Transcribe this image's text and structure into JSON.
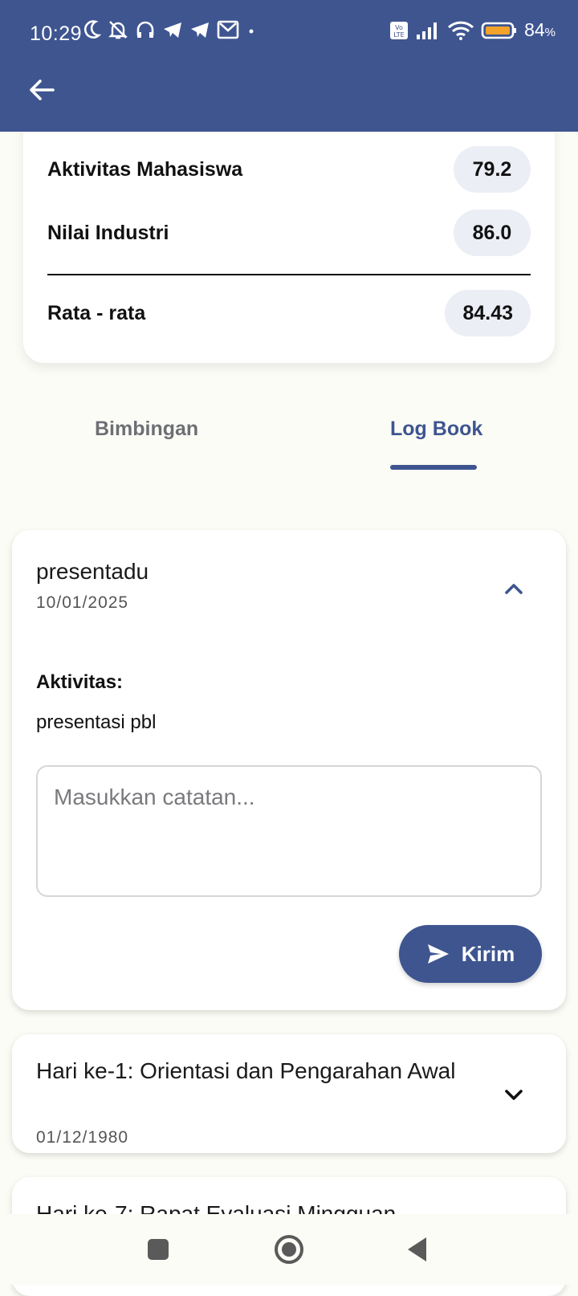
{
  "status_bar": {
    "time": "10:29",
    "battery_text": "84",
    "battery_unit": "%",
    "icons": [
      "moon-icon",
      "bell-off-icon",
      "headset-icon",
      "telegram-icon",
      "telegram-icon",
      "gmail-icon",
      "dot-icon",
      "volte-icon",
      "signal-icon",
      "wifi-icon",
      "battery-icon"
    ]
  },
  "header": {
    "back_icon": "arrow-left-icon"
  },
  "scores": {
    "rows": [
      {
        "label": "Aktivitas Mahasiswa",
        "value": "79.2"
      },
      {
        "label": "Nilai Industri",
        "value": "86.0"
      }
    ],
    "average": {
      "label": "Rata - rata",
      "value": "84.43"
    }
  },
  "tabs": {
    "items": [
      "Bimbingan",
      "Log Book"
    ],
    "active": "Log Book"
  },
  "logbook": {
    "expanded": {
      "title": "presentadu",
      "date": "10/01/2025",
      "activity_label": "Aktivitas:",
      "activity_text": "presentasi pbl",
      "note_placeholder": "Masukkan catatan...",
      "note_value": "",
      "send_label": "Kirim"
    },
    "collapsed": [
      {
        "title": "Hari ke-1: Orientasi dan Pengarahan Awal",
        "date": "01/12/1980"
      },
      {
        "title": "Hari ke-7: Rapat Evaluasi Mingguan",
        "date": ""
      }
    ]
  },
  "colors": {
    "primary": "#3e5590",
    "background": "#fcfcf6",
    "pill": "#eceef6"
  }
}
